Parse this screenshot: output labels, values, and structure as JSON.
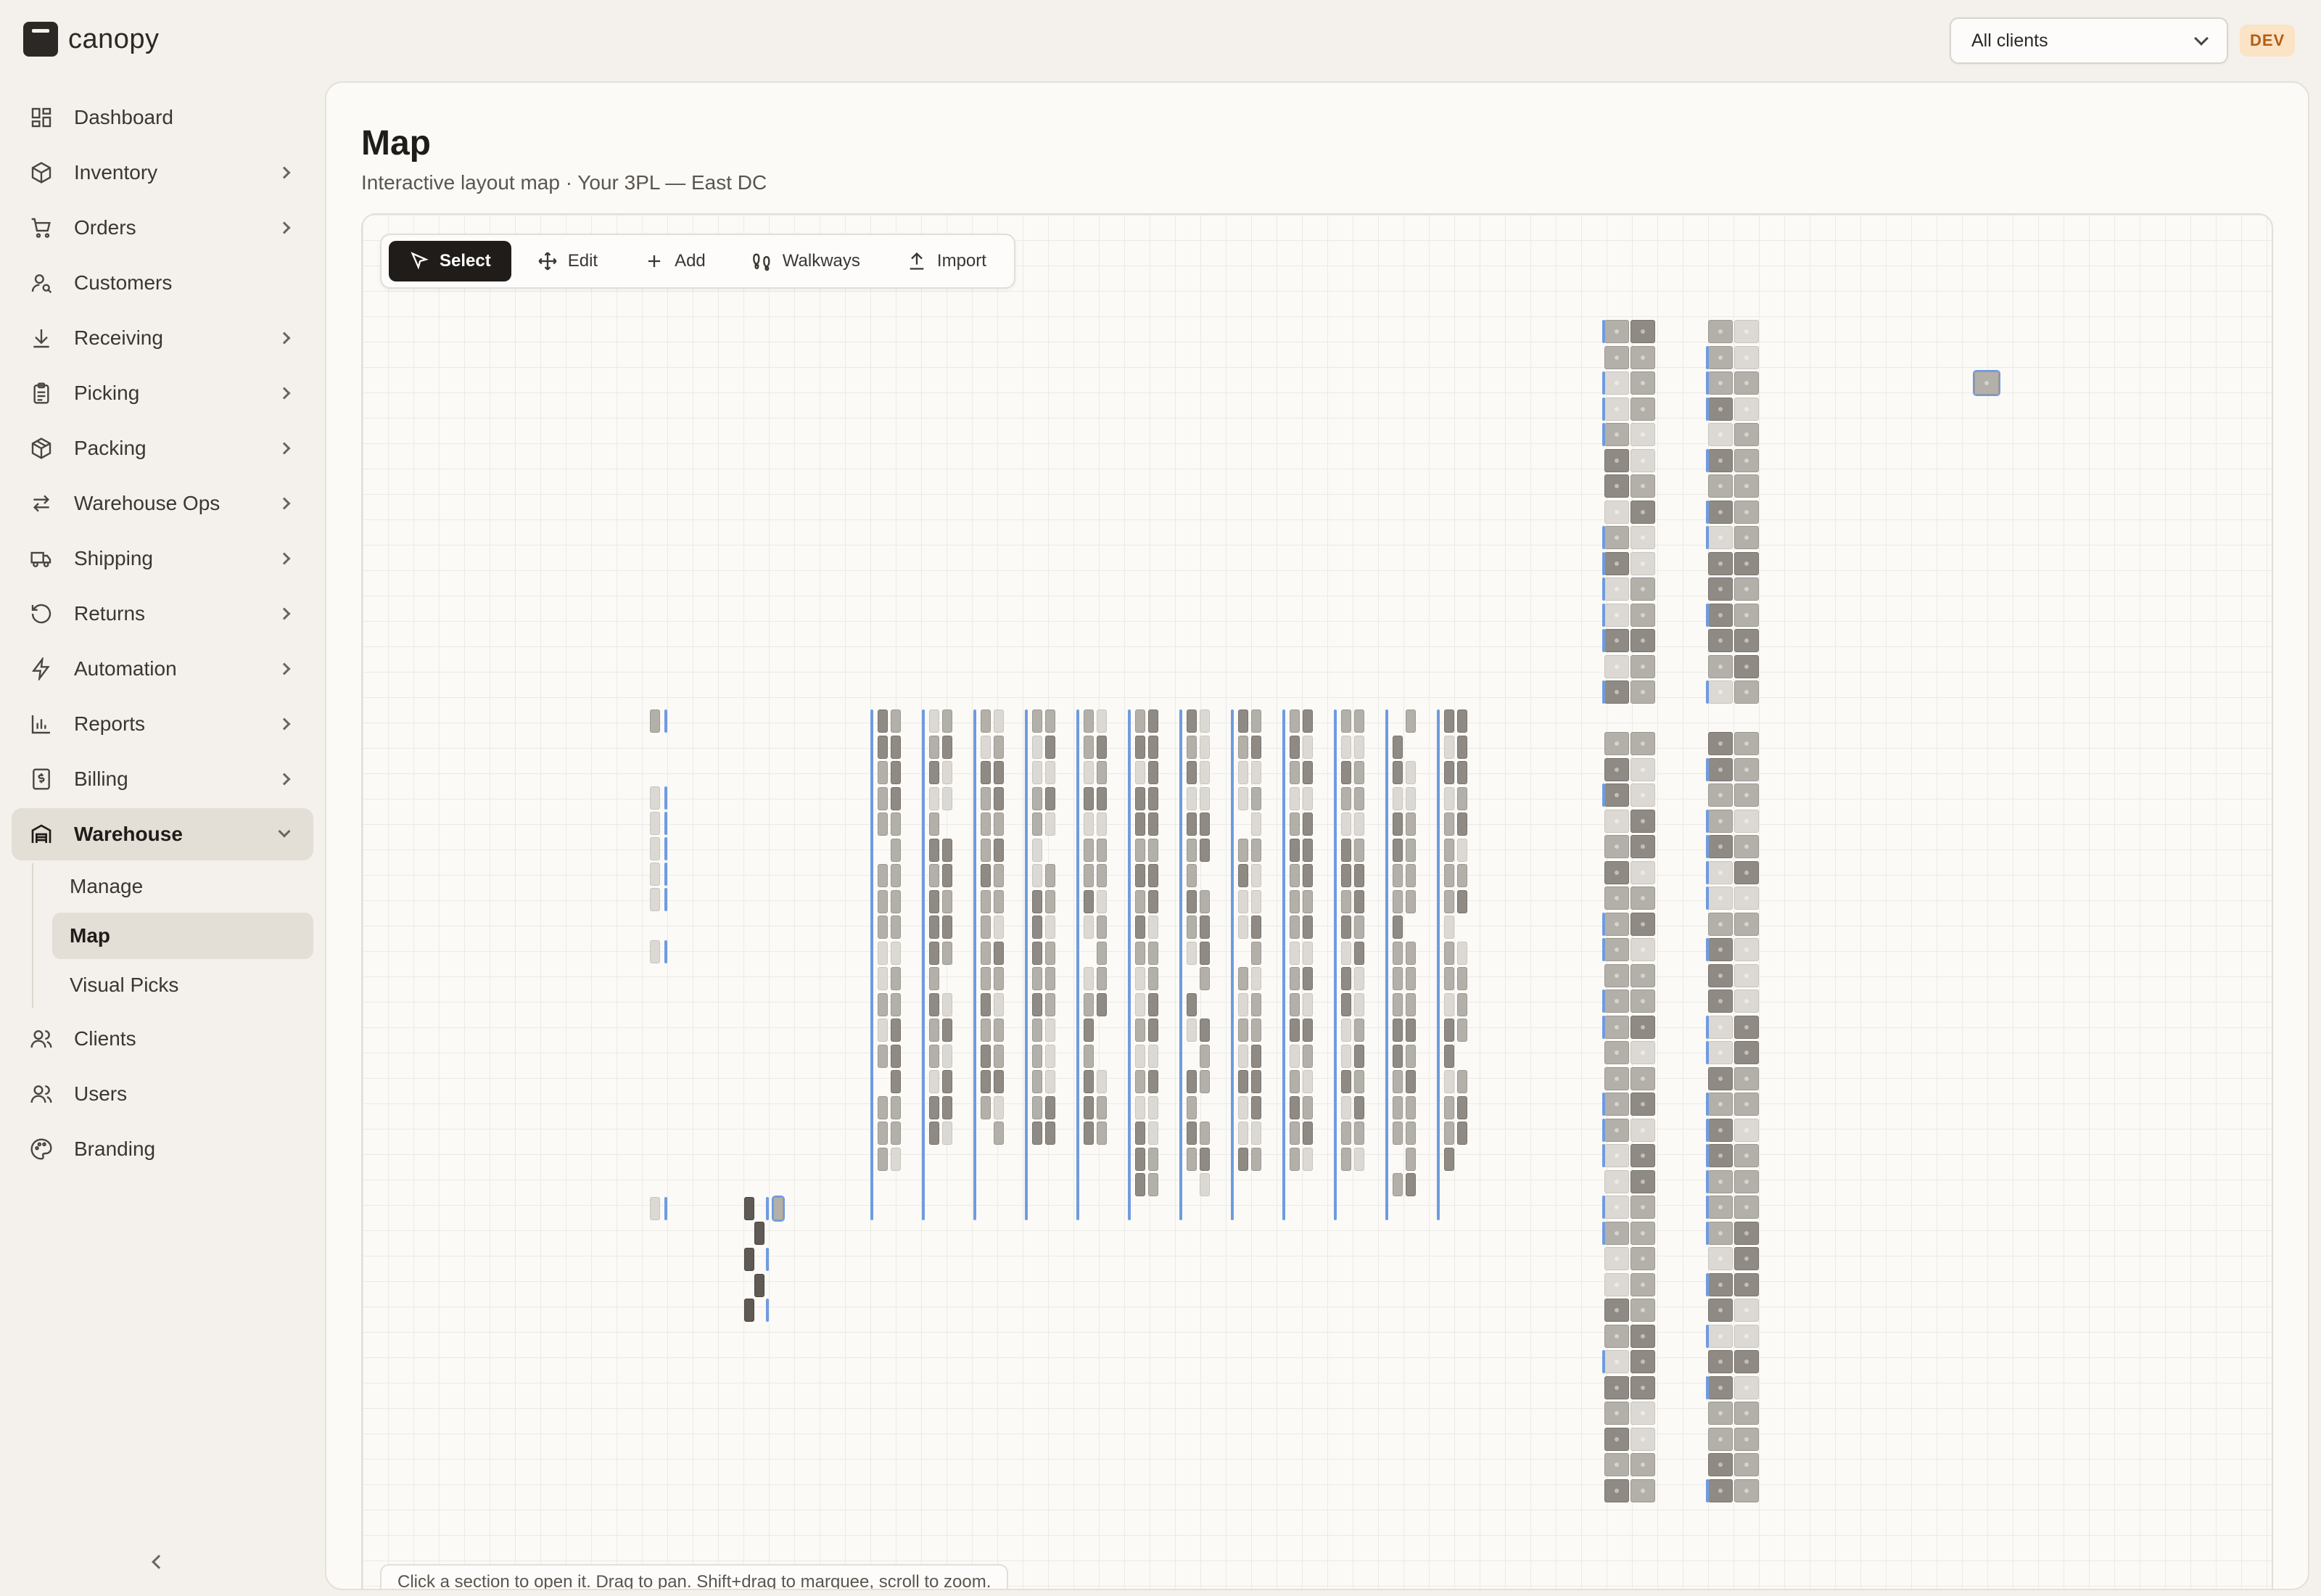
{
  "brand": {
    "name": "canopy",
    "logo_icon": "canopy-logo-icon"
  },
  "topbar": {
    "client_select_value": "All clients",
    "env_badge": "DEV"
  },
  "sidebar": {
    "items": [
      {
        "label": "Dashboard",
        "icon": "dashboard-icon",
        "has_children": false
      },
      {
        "label": "Inventory",
        "icon": "box-icon",
        "has_children": true
      },
      {
        "label": "Orders",
        "icon": "cart-icon",
        "has_children": true
      },
      {
        "label": "Customers",
        "icon": "customer-icon",
        "has_children": false
      },
      {
        "label": "Receiving",
        "icon": "download-icon",
        "has_children": true
      },
      {
        "label": "Picking",
        "icon": "clipboard-icon",
        "has_children": true
      },
      {
        "label": "Packing",
        "icon": "package-icon",
        "has_children": true
      },
      {
        "label": "Warehouse Ops",
        "icon": "arrows-icon",
        "has_children": true
      },
      {
        "label": "Shipping",
        "icon": "truck-icon",
        "has_children": true
      },
      {
        "label": "Returns",
        "icon": "rotate-icon",
        "has_children": true
      },
      {
        "label": "Automation",
        "icon": "bolt-icon",
        "has_children": true
      },
      {
        "label": "Reports",
        "icon": "bar-chart-icon",
        "has_children": true
      },
      {
        "label": "Billing",
        "icon": "invoice-icon",
        "has_children": true
      },
      {
        "label": "Warehouse",
        "icon": "warehouse-icon",
        "has_children": true,
        "open": true
      },
      {
        "label": "Clients",
        "icon": "clients-icon",
        "has_children": false
      },
      {
        "label": "Users",
        "icon": "users-icon",
        "has_children": false
      },
      {
        "label": "Branding",
        "icon": "palette-icon",
        "has_children": false
      }
    ],
    "warehouse_sub": [
      "Manage",
      "Map",
      "Visual Picks"
    ],
    "active_sub": "Map"
  },
  "main": {
    "title": "Map",
    "subtitle": "Interactive layout map · Your 3PL — East DC"
  },
  "toolbar": {
    "select": "Select",
    "edit": "Edit",
    "add": "Add",
    "walkways": "Walkways",
    "import": "Import"
  },
  "hint": "Click a section to open it. Drag to pan. Shift+drag to marquee, scroll to zoom.",
  "colors": {
    "walkway": "#6f9be0",
    "bin_full": "#8f8a84",
    "bin_medium": "#b3afa9",
    "bin_light": "#dcd9d4",
    "bin_dark": "#5f5a54",
    "accent_dark": "#1f1c19",
    "dev_badge_bg": "#fbe3c6",
    "dev_badge_text": "#b45d13"
  }
}
